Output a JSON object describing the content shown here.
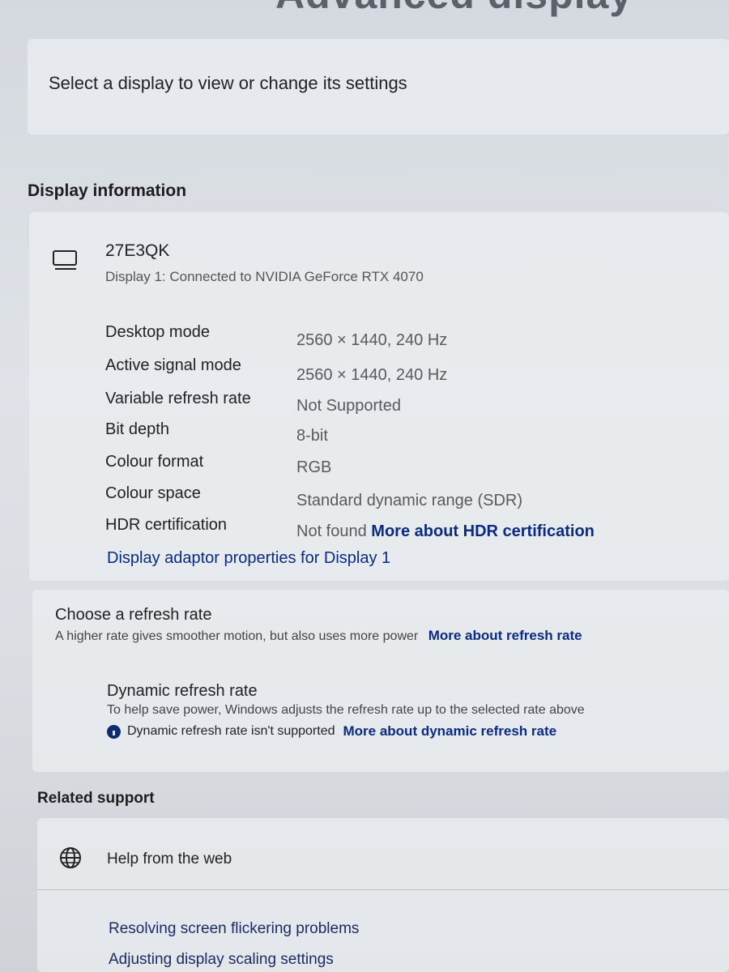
{
  "header": {
    "title_fragment": "Advanced display"
  },
  "select_display": {
    "text": "Select a display to view or change its settings"
  },
  "display_information": {
    "heading": "Display information",
    "monitor": {
      "icon": "monitor-icon",
      "name": "27E3QK",
      "subtitle": "Display 1: Connected to NVIDIA GeForce RTX 4070"
    },
    "properties": [
      {
        "label": "Desktop mode",
        "value": "2560 × 1440, 240 Hz"
      },
      {
        "label": "Active signal mode",
        "value": "2560 × 1440, 240 Hz"
      },
      {
        "label": "Variable refresh rate",
        "value": "Not Supported"
      },
      {
        "label": "Bit depth",
        "value": "8-bit"
      },
      {
        "label": "Colour format",
        "value": "RGB"
      },
      {
        "label": "Colour space",
        "value": "Standard dynamic range (SDR)"
      },
      {
        "label": "HDR certification",
        "value": "Not found",
        "link": "More about HDR certification"
      }
    ],
    "adaptor_link": "Display adaptor properties for Display 1"
  },
  "refresh_rate": {
    "title": "Choose a refresh rate",
    "subtitle": "A higher rate gives smoother motion, but also uses more power",
    "link": "More about refresh rate",
    "dynamic": {
      "title": "Dynamic refresh rate",
      "subtitle": "To help save power, Windows adjusts the refresh rate up to the selected rate above",
      "note": "Dynamic refresh rate isn't supported",
      "note_link": "More about dynamic refresh rate"
    }
  },
  "related_support": {
    "heading": "Related support",
    "help_from_web": "Help from the web",
    "links": [
      "Resolving screen flickering problems",
      "Adjusting display scaling settings"
    ]
  },
  "colors": {
    "link": "#0a2b82",
    "background": "#d8dde3",
    "card": "#eceef1"
  }
}
